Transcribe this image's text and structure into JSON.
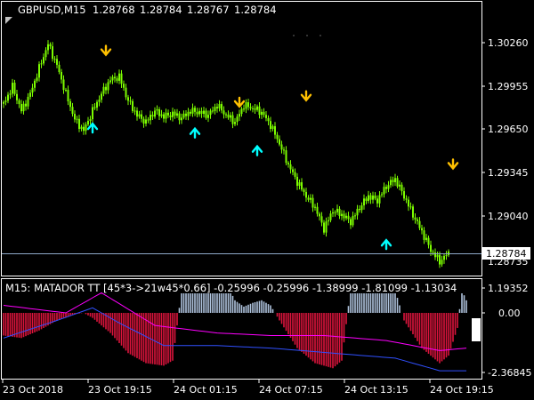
{
  "header": {
    "symbol": "GBPUSD,M15",
    "open": "1.28768",
    "high": "1.28784",
    "low": "1.28767",
    "close": "1.28784"
  },
  "price_axis": {
    "labels": [
      "1.30260",
      "1.29955",
      "1.29650",
      "1.29345",
      "1.29040"
    ],
    "current_price": "1.28784",
    "bottom_label": "1.28735"
  },
  "indicator": {
    "title": "M15:  MATADOR TT [45*3->21w45*0.66] -0.25996 -0.25996 -1.38999 -1.81099 -1.13034",
    "axis_labels": [
      "1.19352",
      "0.00",
      "-2.36845"
    ]
  },
  "time_axis": {
    "labels": [
      "23 Oct 2018",
      "23 Oct 19:15",
      "24 Oct 01:15",
      "24 Oct 07:15",
      "24 Oct 13:15",
      "24 Oct 19:15"
    ]
  },
  "colors": {
    "background": "#000000",
    "bull_candle": "#7CFC00",
    "arrow_down": "#FFC000",
    "arrow_up": "#00FFFF",
    "hist_negative": "#DC143C",
    "hist_positive": "#B0C4DE",
    "line_magenta": "#FF00FF",
    "line_blue": "#3050FF",
    "grid_frame": "#FFFFFF",
    "current_price_line": "#8FA8C8"
  },
  "chart_data": {
    "type": "candlestick",
    "symbol": "GBPUSD,M15",
    "close_path": [
      [
        0,
        1.2983
      ],
      [
        2,
        1.2995
      ],
      [
        4,
        1.2978
      ],
      [
        6,
        1.299
      ],
      [
        8,
        1.3008
      ],
      [
        10,
        1.3025
      ],
      [
        12,
        1.301
      ],
      [
        14,
        1.299
      ],
      [
        16,
        1.2972
      ],
      [
        18,
        1.2964
      ],
      [
        20,
        1.2978
      ],
      [
        22,
        1.299
      ],
      [
        24,
        1.3
      ],
      [
        26,
        1.3002
      ],
      [
        28,
        1.2985
      ],
      [
        30,
        1.2975
      ],
      [
        32,
        1.297
      ],
      [
        34,
        1.2978
      ],
      [
        36,
        1.2974
      ],
      [
        38,
        1.2976
      ],
      [
        40,
        1.2973
      ],
      [
        42,
        1.2978
      ],
      [
        44,
        1.2977
      ],
      [
        46,
        1.2975
      ],
      [
        48,
        1.2982
      ],
      [
        50,
        1.2975
      ],
      [
        52,
        1.297
      ],
      [
        54,
        1.2982
      ],
      [
        56,
        1.298
      ],
      [
        58,
        1.2977
      ],
      [
        60,
        1.2968
      ],
      [
        62,
        1.2955
      ],
      [
        64,
        1.294
      ],
      [
        66,
        1.2928
      ],
      [
        68,
        1.2918
      ],
      [
        70,
        1.291
      ],
      [
        72,
        1.2895
      ],
      [
        74,
        1.2908
      ],
      [
        76,
        1.2905
      ],
      [
        78,
        1.29
      ],
      [
        80,
        1.291
      ],
      [
        82,
        1.2918
      ],
      [
        84,
        1.2915
      ],
      [
        86,
        1.2925
      ],
      [
        88,
        1.293
      ],
      [
        90,
        1.2918
      ],
      [
        92,
        1.2905
      ],
      [
        94,
        1.2893
      ],
      [
        96,
        1.288
      ],
      [
        98,
        1.2872
      ],
      [
        100,
        1.2878
      ]
    ],
    "arrows_down": [
      [
        23,
        1.30175
      ],
      [
        53,
        1.2981
      ],
      [
        68,
        1.29855
      ],
      [
        101,
        1.29375
      ]
    ],
    "arrows_up": [
      [
        20,
        1.2969
      ],
      [
        43,
        1.29655
      ],
      [
        57,
        1.2953
      ],
      [
        86,
        1.2887
      ]
    ],
    "indicator": {
      "type": "histogram",
      "series": [
        {
          "name": "MATADOR TT",
          "values": [
            -0.25996,
            -0.25996,
            -1.38999,
            -1.81099,
            -1.13034
          ]
        }
      ],
      "histogram_profile": [
        [
          0,
          -0.9
        ],
        [
          4,
          -1.0
        ],
        [
          8,
          -0.7
        ],
        [
          12,
          -0.3
        ],
        [
          16,
          -0.05
        ],
        [
          18,
          0.0
        ],
        [
          20,
          -0.2
        ],
        [
          24,
          -0.8
        ],
        [
          28,
          -1.6
        ],
        [
          32,
          -2.0
        ],
        [
          36,
          -2.1
        ],
        [
          38,
          -1.9
        ],
        [
          40,
          0.9
        ],
        [
          44,
          1.4
        ],
        [
          48,
          1.6
        ],
        [
          50,
          1.2
        ],
        [
          52,
          0.5
        ],
        [
          54,
          0.25
        ],
        [
          56,
          0.4
        ],
        [
          58,
          0.5
        ],
        [
          60,
          0.3
        ],
        [
          62,
          -0.3
        ],
        [
          66,
          -1.4
        ],
        [
          70,
          -2.0
        ],
        [
          74,
          -2.2
        ],
        [
          76,
          -1.9
        ],
        [
          78,
          1.0
        ],
        [
          82,
          1.5
        ],
        [
          86,
          1.2
        ],
        [
          88,
          0.9
        ],
        [
          90,
          -0.3
        ],
        [
          94,
          -1.4
        ],
        [
          98,
          -2.0
        ],
        [
          100,
          -1.7
        ],
        [
          102,
          -0.6
        ],
        [
          103,
          0.9
        ],
        [
          104,
          0.5
        ]
      ],
      "magenta_line": [
        [
          0,
          0.3
        ],
        [
          14,
          0.0
        ],
        [
          22,
          0.8
        ],
        [
          34,
          -0.5
        ],
        [
          48,
          -0.8
        ],
        [
          60,
          -0.9
        ],
        [
          72,
          -0.9
        ],
        [
          86,
          -1.1
        ],
        [
          98,
          -1.5
        ],
        [
          104,
          -1.4
        ]
      ],
      "blue_line": [
        [
          0,
          -1.0
        ],
        [
          12,
          -0.3
        ],
        [
          20,
          0.2
        ],
        [
          26,
          -0.4
        ],
        [
          36,
          -1.3
        ],
        [
          48,
          -1.3
        ],
        [
          60,
          -1.4
        ],
        [
          74,
          -1.6
        ],
        [
          88,
          -1.8
        ],
        [
          98,
          -2.3
        ],
        [
          104,
          -2.3
        ]
      ]
    }
  }
}
